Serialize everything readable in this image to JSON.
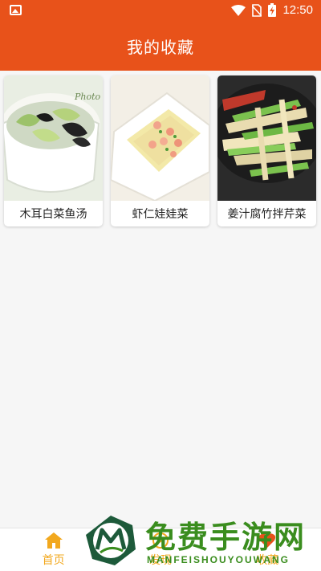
{
  "status_bar": {
    "time": "12:50",
    "icons": [
      "gallery-icon",
      "wifi-icon",
      "no-sim-icon",
      "battery-charging-icon"
    ]
  },
  "header": {
    "title": "我的收藏"
  },
  "favorites": [
    {
      "name": "木耳白菜鱼汤",
      "photo_caption": "Photo"
    },
    {
      "name": "虾仁娃娃菜"
    },
    {
      "name": "姜汁腐竹拌芹菜"
    }
  ],
  "bottom_nav": [
    {
      "label": "首页",
      "icon": "home-icon"
    },
    {
      "label": "发现",
      "icon": "discover-icon"
    },
    {
      "label": "收藏",
      "icon": "favorite-icon"
    }
  ],
  "watermark": {
    "text_cn": "免费手游网",
    "text_en": "MANFEISHOUYOUWANG"
  },
  "colors": {
    "primary": "#e8521a",
    "nav_accent": "#f2a81e",
    "watermark": "#3a8d1e"
  }
}
